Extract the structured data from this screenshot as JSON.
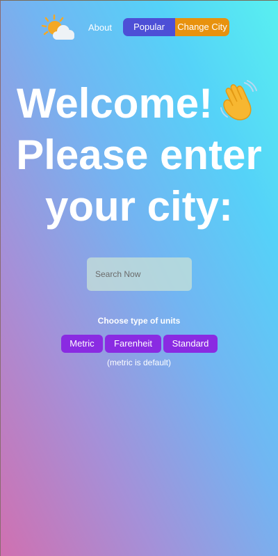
{
  "nav": {
    "logo_icon": "sun-behind-cloud-icon",
    "about_label": "About",
    "popular_label": "Popular Cities",
    "change_label": "Change City"
  },
  "headline": {
    "line1": "Welcome!",
    "line1_icon": "waving-hand-icon",
    "line2": "Please enter",
    "line3": "your city:"
  },
  "search": {
    "placeholder": "Search Now"
  },
  "units": {
    "label": "Choose type of units",
    "options": [
      "Metric",
      "Farenheit",
      "Standard"
    ],
    "note": "(metric is default)"
  },
  "colors": {
    "popular_button": "#4d4fd6",
    "change_button": "#e8920e",
    "unit_button": "#8a2be2"
  }
}
